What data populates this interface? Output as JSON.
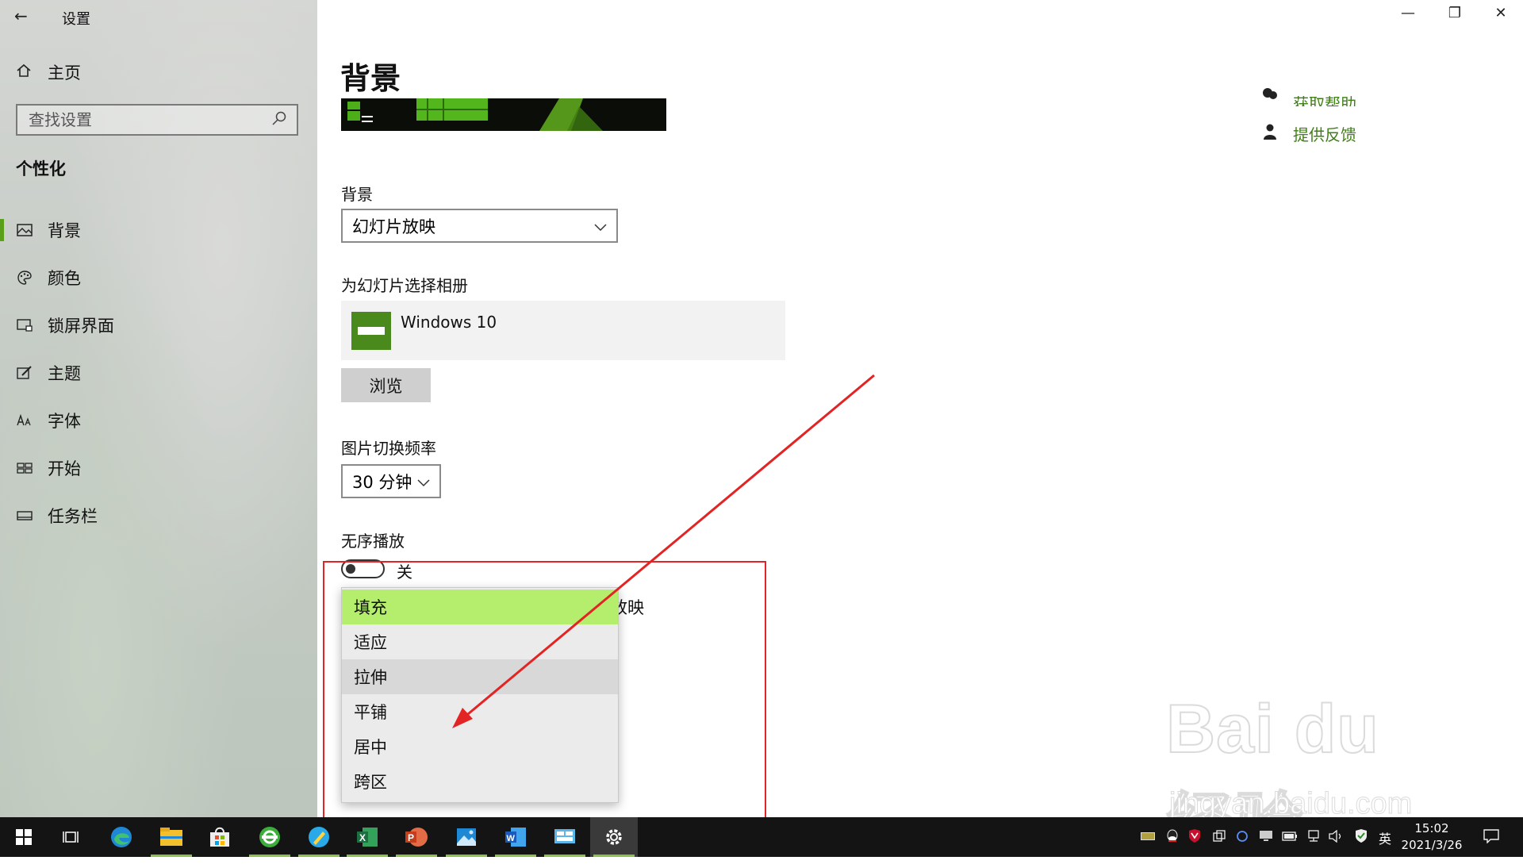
{
  "window": {
    "title": "设置",
    "back_icon": "arrow-left-icon",
    "controls": [
      "minimize-icon",
      "restore-icon",
      "close-icon"
    ]
  },
  "sidebar": {
    "home_label": "主页",
    "search_placeholder": "查找设置",
    "section_title": "个性化",
    "items": [
      {
        "label": "背景",
        "icon": "picture-icon",
        "active": true
      },
      {
        "label": "颜色",
        "icon": "palette-icon",
        "active": false
      },
      {
        "label": "锁屏界面",
        "icon": "lock-screen-icon",
        "active": false
      },
      {
        "label": "主题",
        "icon": "theme-brush-icon",
        "active": false
      },
      {
        "label": "字体",
        "icon": "font-icon",
        "active": false
      },
      {
        "label": "开始",
        "icon": "start-grid-icon",
        "active": false
      },
      {
        "label": "任务栏",
        "icon": "taskbar-icon",
        "active": false
      }
    ]
  },
  "main": {
    "page_title": "背景",
    "help": {
      "get_help": "获取帮助",
      "feedback": "提供反馈"
    },
    "background": {
      "label": "背景",
      "value": "幻灯片放映"
    },
    "album": {
      "label": "为幻灯片选择相册",
      "name": "Windows 10",
      "browse": "浏览"
    },
    "frequency": {
      "label": "图片切换频率",
      "value": "30 分钟"
    },
    "shuffle": {
      "label": "无序播放",
      "state": "关",
      "on": false
    },
    "behind_text_fragment": "放映",
    "fit_dropdown": {
      "options": [
        "填充",
        "适应",
        "拉伸",
        "平铺",
        "居中",
        "跨区"
      ],
      "selected": "填充",
      "hovered": "拉伸"
    }
  },
  "taskbar": {
    "apps": [
      "windows-start-icon",
      "task-view-icon",
      "edge-icon",
      "file-explorer-icon",
      "store-icon",
      "browser-360-icon",
      "notes-icon",
      "excel-icon",
      "powerpoint-icon",
      "photos-icon",
      "word-icon",
      "control-panel-icon",
      "settings-gear-icon"
    ],
    "ime": "英",
    "time": "15:02",
    "date": "2021/3/26"
  },
  "watermark": {
    "brand": "Bai du 经验",
    "url": "jingyan.baidu.com"
  },
  "colors": {
    "accent": "#5a9f1a",
    "link": "#3f7f16",
    "selected_option": "#b5ee6d",
    "annotation": "#e32424"
  }
}
